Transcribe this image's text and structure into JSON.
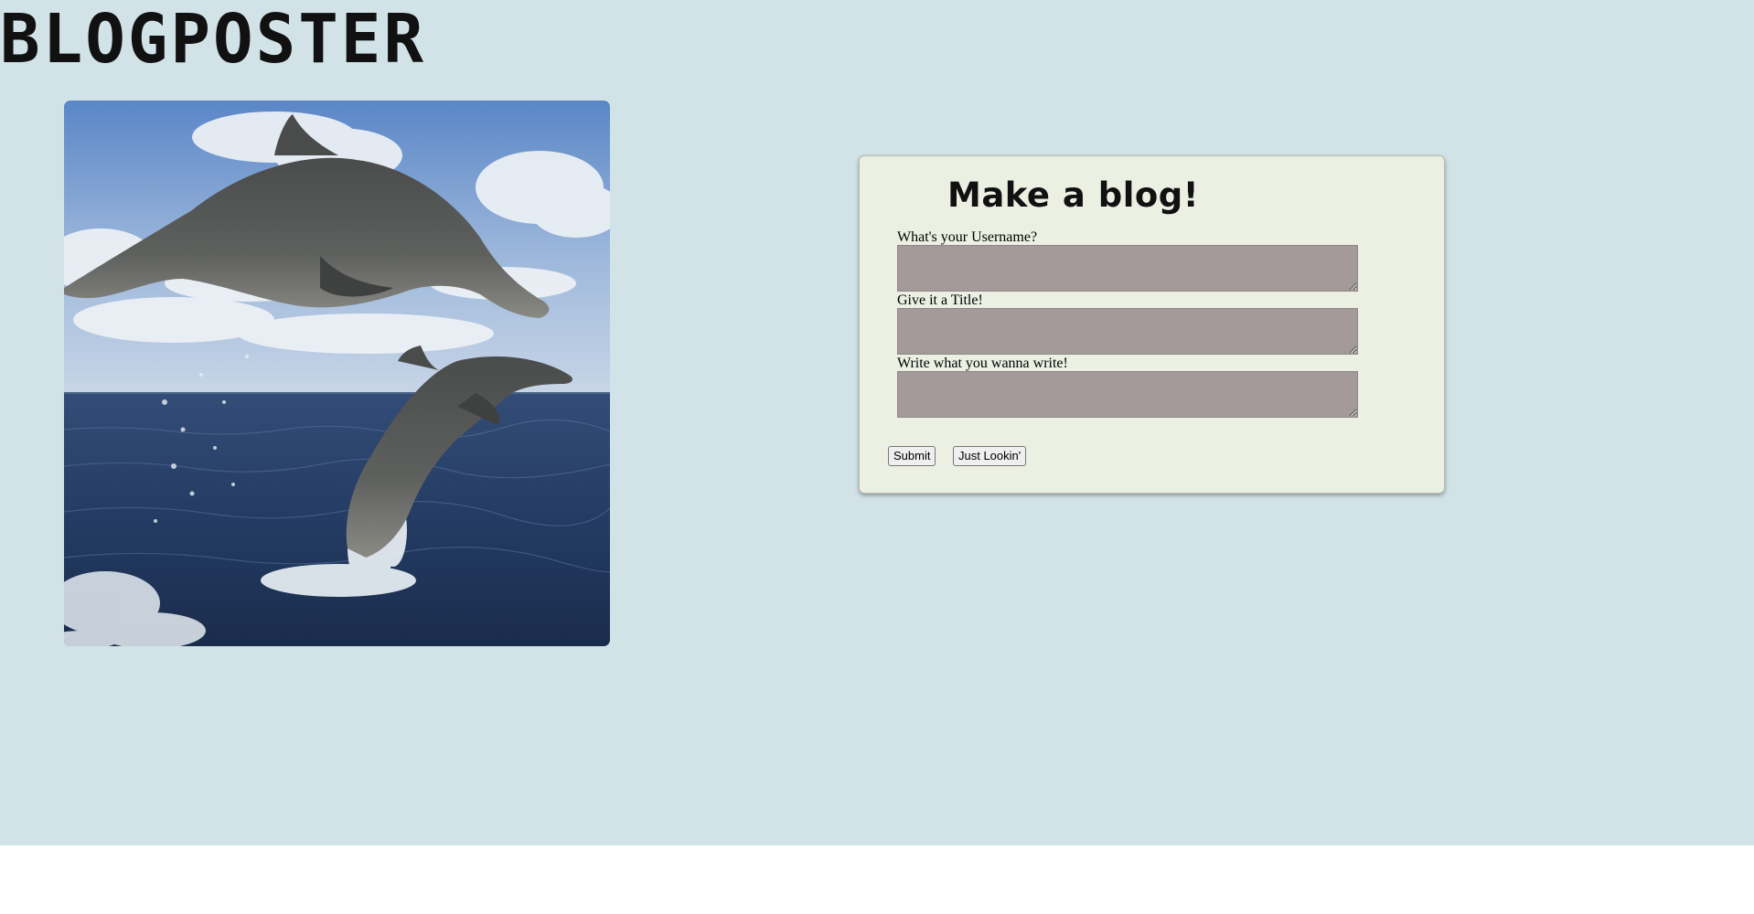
{
  "site": {
    "title": "BLOGPOSTER"
  },
  "hero": {
    "alt": "Two dolphins leaping out of the ocean"
  },
  "form": {
    "heading": "Make a blog!",
    "username_label": "What's your Username?",
    "username_value": "",
    "title_label": "Give it a Title!",
    "title_value": "",
    "body_label": "Write what you wanna write!",
    "body_value": "",
    "submit_label": "Submit",
    "browse_label": "Just Lookin'"
  },
  "colors": {
    "page_background": "#d2e3e7",
    "panel_background": "#ebf0e3",
    "textarea_background": "#a39a99"
  }
}
